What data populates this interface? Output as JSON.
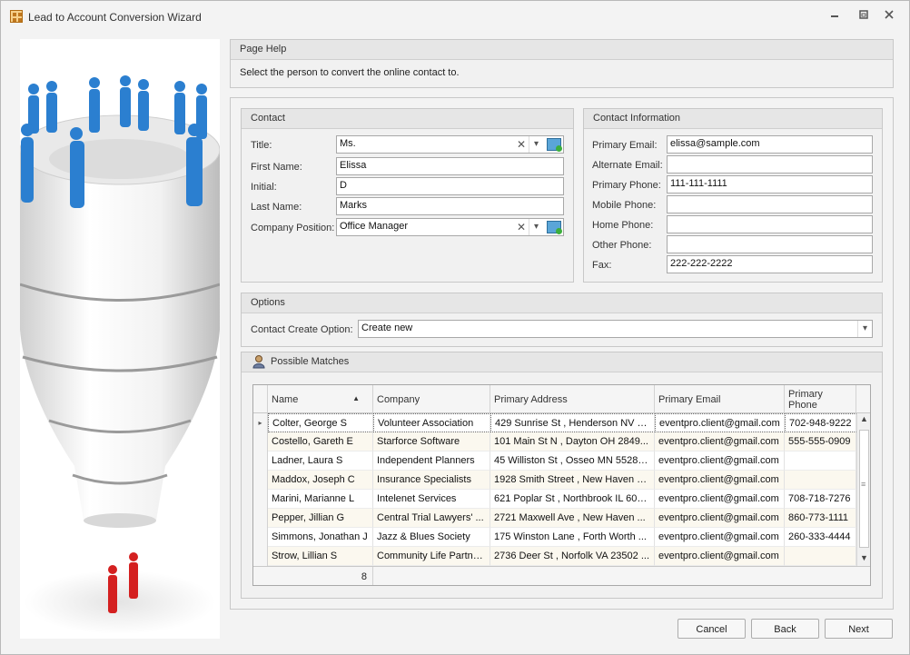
{
  "window": {
    "title": "Lead to Account Conversion Wizard"
  },
  "page_help": {
    "header": "Page Help",
    "text": "Select the person to convert the online contact to."
  },
  "contact": {
    "header": "Contact",
    "title_label": "Title:",
    "title_value": "Ms.",
    "first_name_label": "First Name:",
    "first_name_value": "Elissa",
    "initial_label": "Initial:",
    "initial_value": "D",
    "last_name_label": "Last Name:",
    "last_name_value": "Marks",
    "position_label": "Company Position:",
    "position_value": "Office Manager"
  },
  "contact_info": {
    "header": "Contact Information",
    "primary_email_label": "Primary Email:",
    "primary_email_value": "elissa@sample.com",
    "alternate_email_label": "Alternate Email:",
    "alternate_email_value": "",
    "primary_phone_label": "Primary Phone:",
    "primary_phone_value": "111-111-1111",
    "mobile_phone_label": "Mobile Phone:",
    "mobile_phone_value": "",
    "home_phone_label": "Home Phone:",
    "home_phone_value": "",
    "other_phone_label": "Other Phone:",
    "other_phone_value": "",
    "fax_label": "Fax:",
    "fax_value": "222-222-2222"
  },
  "options": {
    "header": "Options",
    "create_option_label": "Contact Create Option:",
    "create_option_value": "Create new"
  },
  "matches": {
    "header": "Possible Matches",
    "columns": [
      "Name",
      "Company",
      "Primary Address",
      "Primary Email",
      "Primary Phone"
    ],
    "rows": [
      [
        "Colter, George S",
        "Volunteer Association",
        "429 Sunrise St , Henderson NV 8...",
        "eventpro.client@gmail.com",
        "702-948-9222"
      ],
      [
        "Costello, Gareth E",
        "Starforce Software",
        "101 Main St N , Dayton OH 2849...",
        "eventpro.client@gmail.com",
        "555-555-0909"
      ],
      [
        "Ladner, Laura S",
        "Independent Planners",
        "45 Williston St , Osseo MN 55289 ...",
        "eventpro.client@gmail.com",
        ""
      ],
      [
        "Maddox, Joseph C",
        "Insurance Specialists",
        "1928 Smith Street , New Haven C...",
        "eventpro.client@gmail.com",
        ""
      ],
      [
        "Marini, Marianne L",
        "Intelenet Services",
        "621 Poplar St , Northbrook IL 600...",
        "eventpro.client@gmail.com",
        "708-718-7276"
      ],
      [
        "Pepper, Jillian G",
        "Central Trial Lawyers' ...",
        "2721 Maxwell Ave , New Haven ...",
        "eventpro.client@gmail.com",
        "860-773-1111"
      ],
      [
        "Simmons, Jonathan J",
        "Jazz & Blues Society",
        "175 Winston Lane , Forth Worth ...",
        "eventpro.client@gmail.com",
        "260-333-4444"
      ],
      [
        "Strow, Lillian S",
        "Community Life Partne...",
        "2736 Deer St , Norfolk VA 23502 ...",
        "eventpro.client@gmail.com",
        ""
      ]
    ],
    "count": "8"
  },
  "buttons": {
    "cancel": "Cancel",
    "back": "Back",
    "next": "Next"
  },
  "colors": {
    "person_blue": "#2b7fd0",
    "person_red": "#d42020"
  }
}
